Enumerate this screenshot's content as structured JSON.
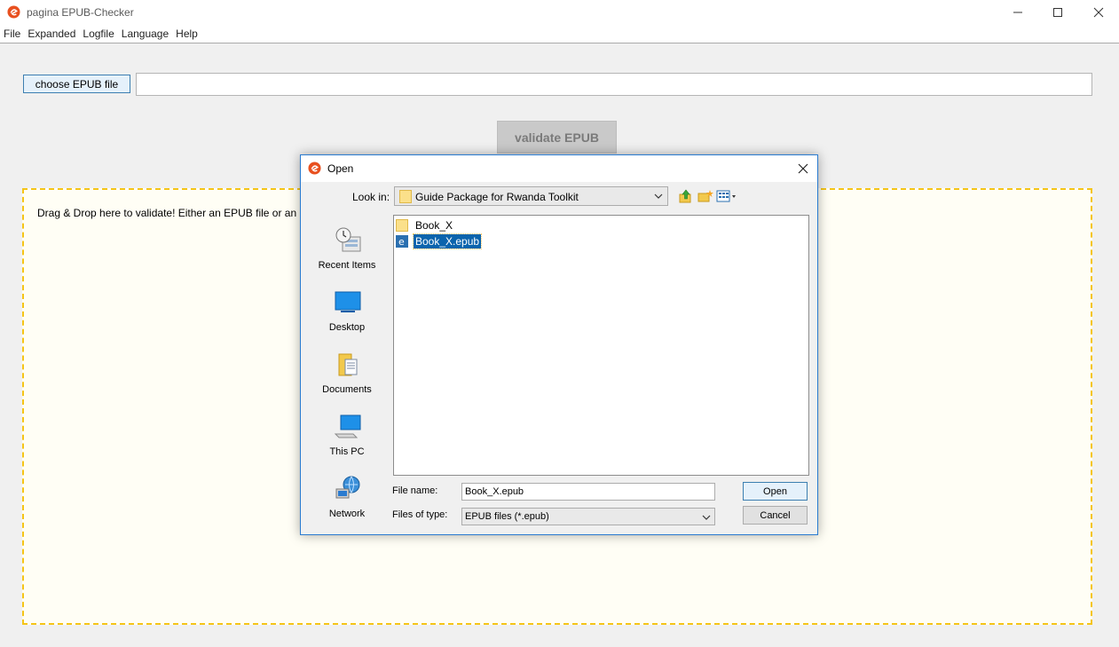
{
  "window": {
    "title": "pagina EPUB-Checker"
  },
  "menu": [
    "File",
    "Expanded",
    "Logfile",
    "Language",
    "Help"
  ],
  "main": {
    "choose_button": "choose EPUB file",
    "path_value": "",
    "validate_button": "validate EPUB",
    "drop_text": "Drag & Drop here to validate! Either an EPUB file or an expanded EPUB folder."
  },
  "dialog": {
    "title": "Open",
    "look_in_label": "Look in:",
    "look_in_value": "Guide Package for Rwanda Toolkit",
    "places": [
      "Recent Items",
      "Desktop",
      "Documents",
      "This PC",
      "Network"
    ],
    "files": [
      {
        "name": "Book_X",
        "type": "folder",
        "selected": false
      },
      {
        "name": "Book_X.epub",
        "type": "epub",
        "selected": true
      }
    ],
    "file_name_label": "File name:",
    "file_name_value": "Book_X.epub",
    "file_type_label": "Files of type:",
    "file_type_value": "EPUB files (*.epub)",
    "open_button": "Open",
    "cancel_button": "Cancel"
  },
  "colors": {
    "accent": "#0a64ad",
    "dropzone_border": "#f5c518",
    "dialog_border": "#2a7bd0"
  }
}
